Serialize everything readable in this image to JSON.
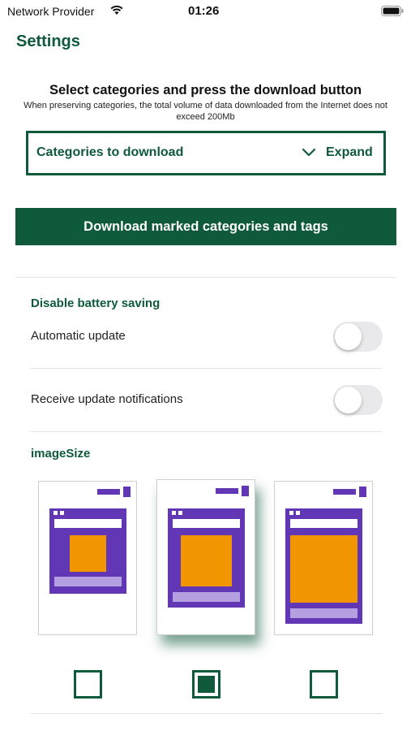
{
  "status_bar": {
    "provider": "Network Provider",
    "time": "01:26",
    "wifi_icon": "wifi-icon",
    "battery_icon": "battery-icon"
  },
  "page_title": "Settings",
  "intro": {
    "heading": "Select categories and press the download button",
    "note": "When preserving categories, the total volume of data downloaded from the Internet does not exceed  200Mb"
  },
  "categories": {
    "label": "Categories to download",
    "expand_label": "Expand",
    "chevron_icon": "chevron-down-icon"
  },
  "download_button": "Download marked categories and tags",
  "battery_section": {
    "title": "Disable battery saving",
    "rows": [
      {
        "label": "Automatic update",
        "enabled": false
      },
      {
        "label": "Receive update notifications",
        "enabled": false
      }
    ]
  },
  "image_size": {
    "title": "imageSize",
    "options": [
      {
        "name": "small",
        "selected": false
      },
      {
        "name": "medium",
        "selected": true
      },
      {
        "name": "large",
        "selected": false
      }
    ]
  },
  "colors": {
    "brand": "#0e5a3a",
    "purple": "#6237b5",
    "orange": "#f19500",
    "lavender": "#b4a0e0"
  }
}
